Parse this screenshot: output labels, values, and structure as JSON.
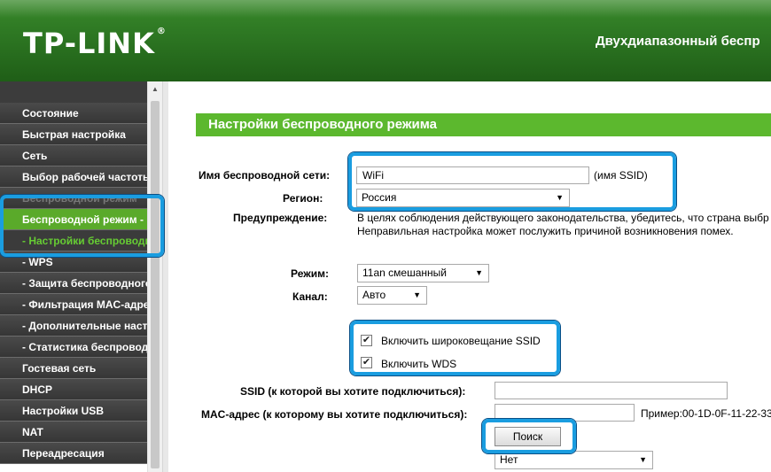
{
  "header": {
    "logo": "TP-LINK",
    "logo_mark": "®",
    "title": "Двухдиапазонный беспр"
  },
  "sidebar": {
    "items": [
      {
        "label": "Состояние"
      },
      {
        "label": "Быстрая настройка"
      },
      {
        "label": "Сеть"
      },
      {
        "label": "Выбор рабочей частоты"
      },
      {
        "label": "Беспроводной режим"
      },
      {
        "label": "Беспроводной режим -"
      },
      {
        "label": "- Настройки беспроводного"
      },
      {
        "label": "- WPS"
      },
      {
        "label": "- Защита беспроводного"
      },
      {
        "label": "- Фильтрация MAC-адресов"
      },
      {
        "label": "- Дополнительные настройки"
      },
      {
        "label": "- Статистика беспроводного"
      },
      {
        "label": "Гостевая сеть"
      },
      {
        "label": "DHCP"
      },
      {
        "label": "Настройки USB"
      },
      {
        "label": "NAT"
      },
      {
        "label": "Переадресация"
      }
    ]
  },
  "main": {
    "section_title": "Настройки беспроводного режима",
    "ssid_label": "Имя беспроводной сети:",
    "ssid_value": "WiFi",
    "ssid_hint": "(имя SSID)",
    "region_label": "Регион:",
    "region_value": "Россия",
    "warning_label": "Предупреждение:",
    "warning_line1": "В целях соблюдения действующего законодательства, убедитесь, что страна выбр",
    "warning_line2": "Неправильная настройка может послужить причиной возникновения помех.",
    "mode_label": "Режим:",
    "mode_value": "11an смешанный",
    "channel_label": "Канал:",
    "channel_value": "Авто",
    "broadcast_label": "Включить широковещание SSID",
    "wds_label": "Включить WDS",
    "wds_ssid_label": "SSID (к которой вы хотите подключиться):",
    "wds_mac_label": "MAC-адрес (к которому вы хотите подключиться):",
    "mac_example": "Пример:00-1D-0F-11-22-33",
    "search_button": "Поиск",
    "key_value": "Нет"
  },
  "colors": {
    "header_green": "#2f7a24",
    "section_green": "#5cb82e",
    "highlight_blue": "#1a9de0"
  }
}
